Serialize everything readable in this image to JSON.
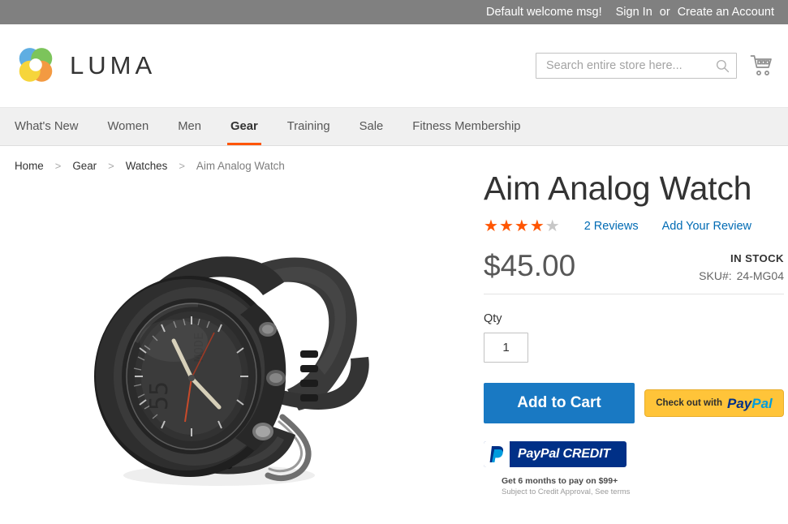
{
  "top_panel": {
    "welcome_message": "Default welcome msg!",
    "sign_in_label": "Sign In",
    "separator": "or",
    "create_account_label": "Create an Account"
  },
  "header": {
    "logo_text": "LUMA",
    "logo_icon": "luma-flower-icon",
    "search": {
      "placeholder": "Search entire store here...",
      "value": "",
      "icon": "search-icon"
    },
    "cart_icon": "shopping-cart-icon"
  },
  "nav": {
    "items": [
      {
        "label": "What's New",
        "active": false
      },
      {
        "label": "Women",
        "active": false
      },
      {
        "label": "Men",
        "active": false
      },
      {
        "label": "Gear",
        "active": true
      },
      {
        "label": "Training",
        "active": false
      },
      {
        "label": "Sale",
        "active": false
      },
      {
        "label": "Fitness Membership",
        "active": false
      }
    ],
    "active_underline_color": "#ff5501"
  },
  "breadcrumbs": {
    "separator": ">",
    "items": [
      {
        "label": "Home",
        "current": false
      },
      {
        "label": "Gear",
        "current": false
      },
      {
        "label": "Watches",
        "current": false
      },
      {
        "label": "Aim Analog Watch",
        "current": true
      }
    ]
  },
  "product": {
    "title": "Aim Analog Watch",
    "image_alt": "Aim Analog Watch",
    "rating": {
      "stars_filled": 4,
      "stars_total": 5,
      "filled_color": "#ff5501",
      "empty_color": "#c7c7c7",
      "reviews_label": "2 Reviews",
      "add_review_label": "Add Your Review"
    },
    "price": "$45.00",
    "stock_status": "IN STOCK",
    "sku_label": "SKU#:",
    "sku_value": "24-MG04",
    "qty_label": "Qty",
    "qty_value": "1",
    "add_to_cart_label": "Add to Cart",
    "add_to_cart_color": "#1979c3",
    "paypal_checkout": {
      "prefix_label": "Check out with",
      "brand_part1": "Pay",
      "brand_part2": "Pal",
      "background_color": "#ffc439"
    },
    "paypal_credit": {
      "brand": "PayPal ",
      "brand_suffix": "CREDIT",
      "background_color": "#003087",
      "fine_print_1": "Get 6 months to pay on $99+",
      "fine_print_2": "Subject to Credit Approval, See terms"
    }
  }
}
